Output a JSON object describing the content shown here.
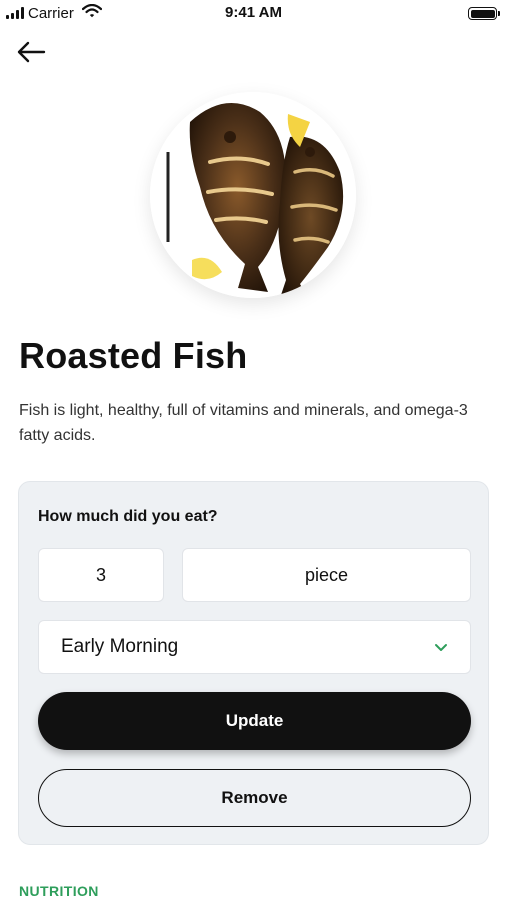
{
  "status_bar": {
    "carrier": "Carrier",
    "time": "9:41 AM"
  },
  "icons": {
    "back": "arrow-left-icon",
    "signal": "signal-icon",
    "wifi": "wifi-icon",
    "battery": "battery-icon",
    "dropdown": "chevron-down-icon"
  },
  "dish": {
    "title": "Roasted Fish",
    "description": "Fish is light, healthy, full of vitamins and minerals, and omega-3 fatty acids."
  },
  "portion": {
    "question": "How much did you eat?",
    "quantity": "3",
    "unit": "piece",
    "meal_time": "Early Morning",
    "update_label": "Update",
    "remove_label": "Remove"
  },
  "sections": {
    "nutrition": "NUTRITION"
  },
  "colors": {
    "accent_green": "#2e9e5b",
    "primary_button": "#111111",
    "card_background": "#eef1f4"
  }
}
